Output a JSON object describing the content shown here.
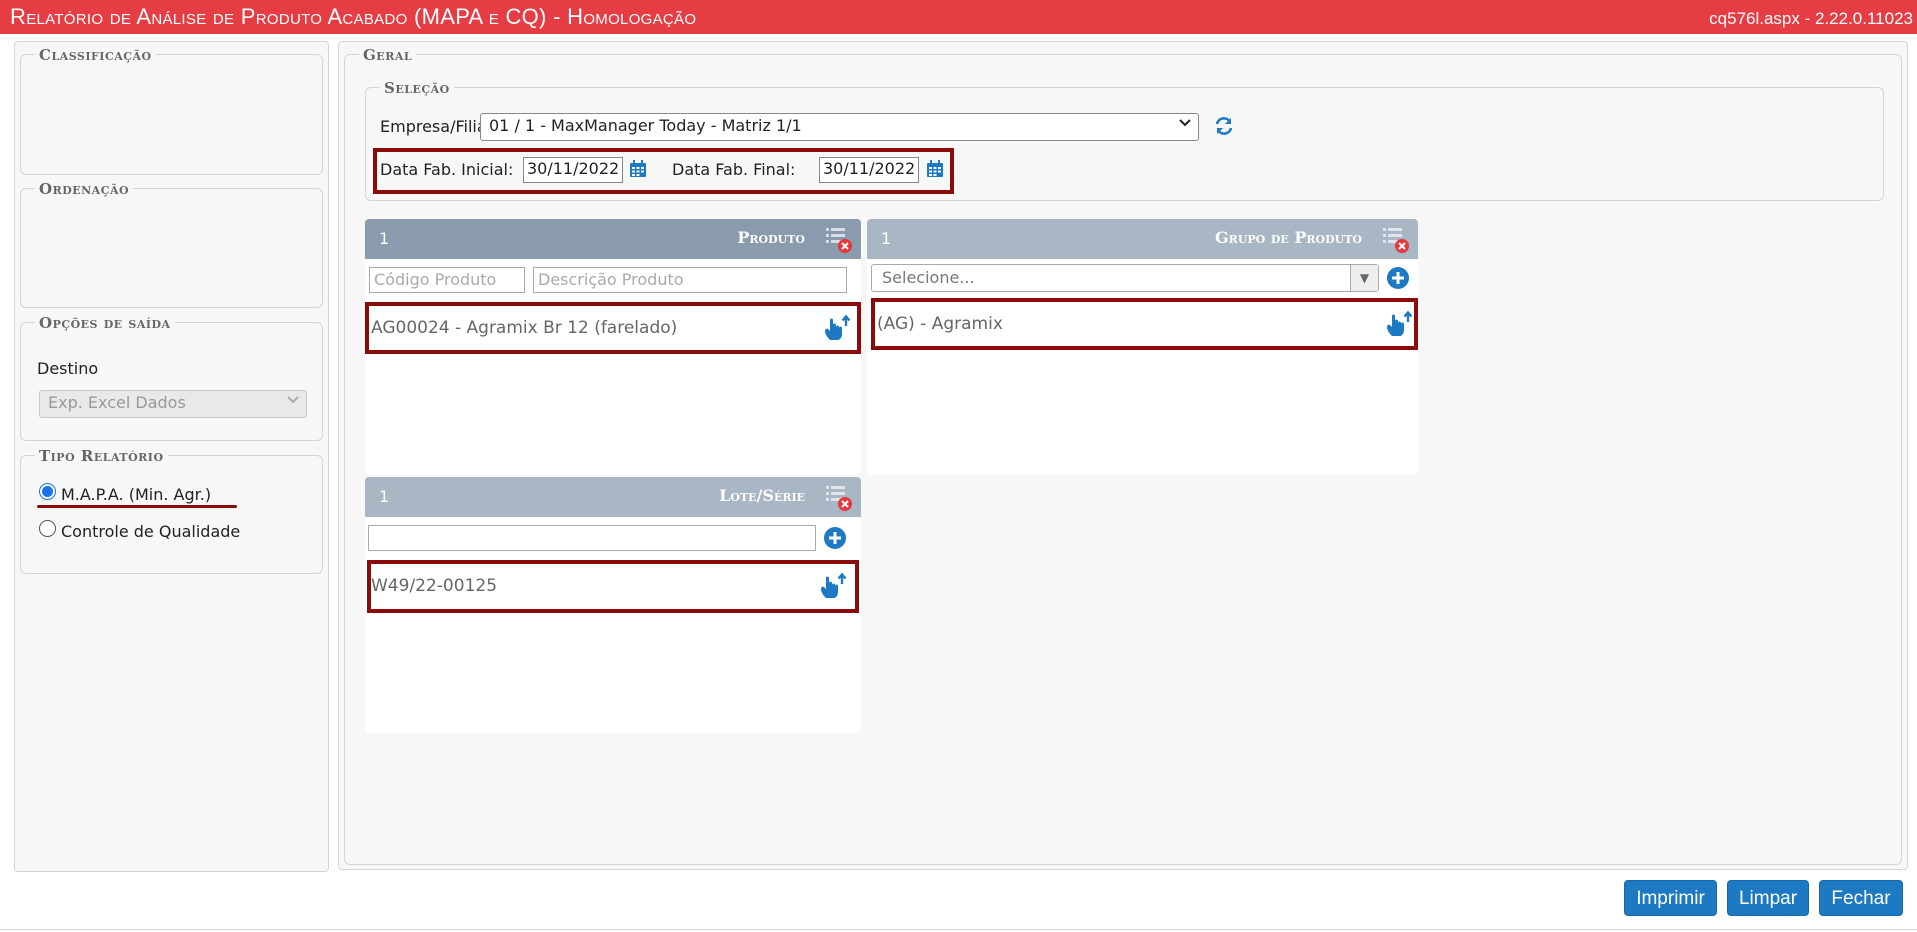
{
  "header": {
    "title": "Relatório de Análise de Produto Acabado (MAPA e CQ)  - Homologação",
    "version": "cq576l.aspx - 2.22.0.11023"
  },
  "sidebar": {
    "classificacao_legend": "Classificação",
    "ordenacao_legend": "Ordenação",
    "opcoes_saida": {
      "legend": "Opções de saída",
      "destino_label": "Destino",
      "destino_value": "Exp. Excel Dados"
    },
    "tipo_relatorio": {
      "legend": "Tipo Relatório",
      "options": [
        {
          "label": "M.A.P.A. (Min. Agr.)",
          "checked": true
        },
        {
          "label": "Controle de Qualidade",
          "checked": false
        }
      ]
    }
  },
  "geral": {
    "legend": "Geral",
    "selecao": {
      "legend": "Seleção",
      "empresa_label": "Empresa/Filial:",
      "empresa_value": "01 / 1 - MaxManager Today - Matriz 1/1",
      "data_inicial_label": "Data Fab. Inicial:",
      "data_inicial_value": "30/11/2022",
      "data_final_label": "Data Fab. Final:",
      "data_final_value": "30/11/2022"
    },
    "produto": {
      "count": "1",
      "title": "Produto",
      "codigo_placeholder": "Código Produto",
      "descricao_placeholder": "Descrição Produto",
      "items": [
        "AG00024 - Agramix Br 12 (farelado)"
      ]
    },
    "grupo_produto": {
      "count": "1",
      "title": "Grupo de Produto",
      "select_placeholder": "Selecione...",
      "items": [
        "(AG) - Agramix"
      ]
    },
    "lote_serie": {
      "count": "1",
      "title": "Lote/Série",
      "input_value": "",
      "items": [
        "W49/22-00125"
      ]
    }
  },
  "buttons": {
    "imprimir": "Imprimir",
    "limpar": "Limpar",
    "fechar": "Fechar"
  },
  "colors": {
    "header_red": "#e63c44",
    "section_header_active": "#8a9bad",
    "section_header_inactive": "#a9b6c4",
    "button_blue": "#1d7ac2",
    "highlight_red": "#8b0b0b"
  }
}
